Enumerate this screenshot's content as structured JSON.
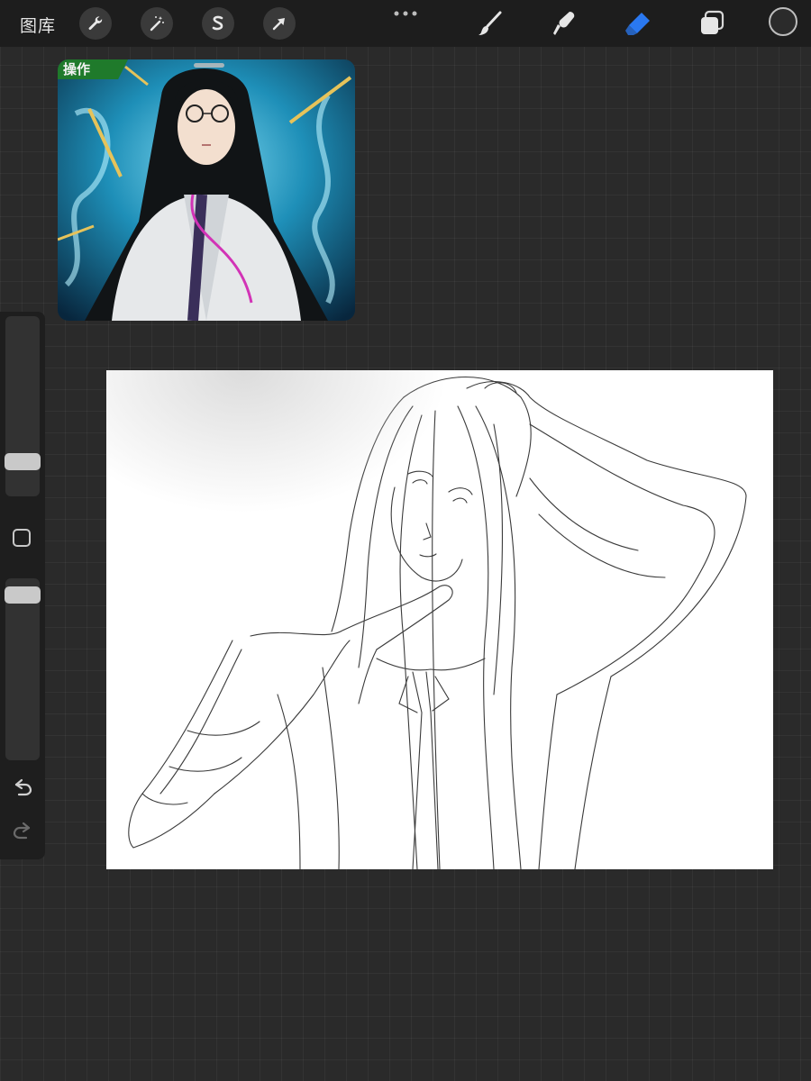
{
  "topbar": {
    "gallery_label": "图库",
    "left_tools": [
      {
        "icon": "wrench-icon",
        "name": "actions"
      },
      {
        "icon": "magic-wand-icon",
        "name": "adjustments"
      },
      {
        "icon": "selection-s-icon",
        "name": "selection"
      },
      {
        "icon": "arrow-cursor-icon",
        "name": "transform"
      }
    ],
    "more_icon": "more-dots-icon",
    "right_tools": [
      {
        "icon": "brush-icon",
        "name": "paint"
      },
      {
        "icon": "smudge-icon",
        "name": "smudge"
      },
      {
        "icon": "eraser-icon",
        "name": "erase",
        "active": true
      },
      {
        "icon": "layers-icon",
        "name": "layers"
      }
    ],
    "active_color": "#2b2b2b",
    "accent_color": "#2a78f0"
  },
  "reference": {
    "banner_text": "操作",
    "icon": "reference-image"
  },
  "sidebar": {
    "size_level": 0.16,
    "opacity_level": 0.95,
    "modify_icon": "square-modify-icon",
    "undo_icon": "undo-arrow-icon",
    "redo_icon": "redo-arrow-icon"
  },
  "canvas": {
    "background": "#ffffff",
    "content": "pencil-sketch"
  }
}
